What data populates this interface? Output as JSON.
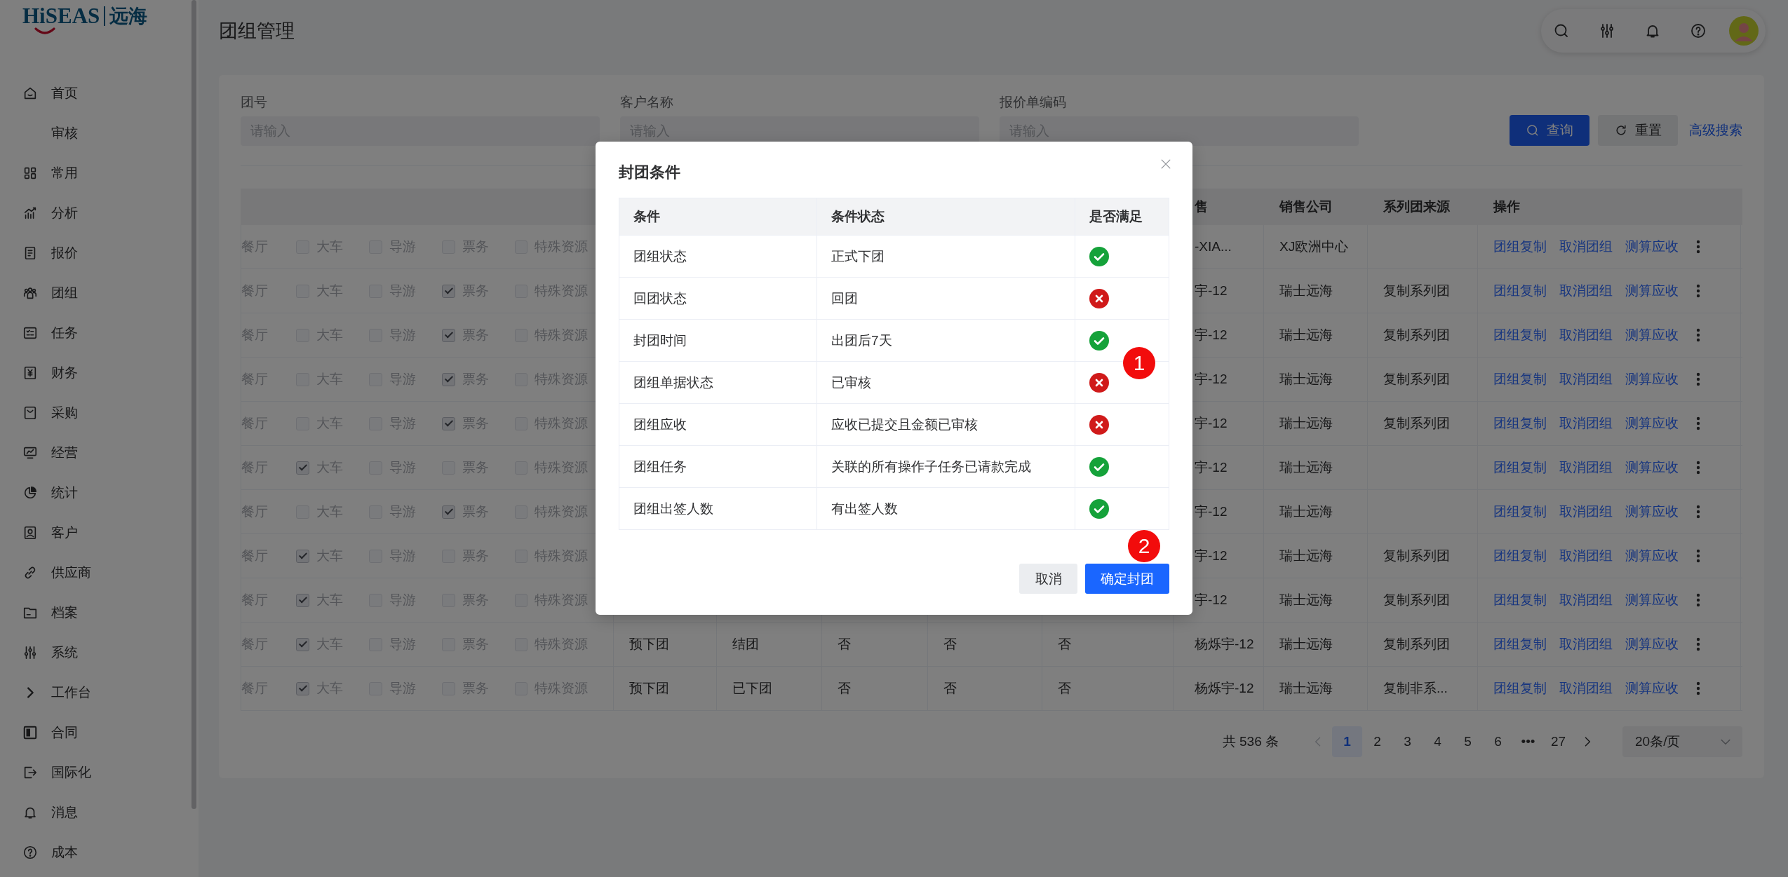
{
  "logo": {
    "name": "HiSEAS",
    "name_cn": "远海"
  },
  "sidebar": {
    "items": [
      {
        "label": "首页"
      },
      {
        "label": "审核"
      },
      {
        "label": "常用"
      },
      {
        "label": "分析"
      },
      {
        "label": "报价"
      },
      {
        "label": "团组"
      },
      {
        "label": "任务"
      },
      {
        "label": "财务"
      },
      {
        "label": "采购"
      },
      {
        "label": "经营"
      },
      {
        "label": "统计"
      },
      {
        "label": "客户"
      },
      {
        "label": "供应商"
      },
      {
        "label": "档案"
      },
      {
        "label": "系统"
      },
      {
        "label": "工作台"
      },
      {
        "label": "合同"
      },
      {
        "label": "国际化"
      },
      {
        "label": "消息"
      },
      {
        "label": "成本"
      }
    ]
  },
  "header": {
    "title": "团组管理"
  },
  "filters": {
    "fields": [
      {
        "label": "团号",
        "placeholder": "请输入"
      },
      {
        "label": "客户名称",
        "placeholder": "请输入"
      },
      {
        "label": "报价单编码",
        "placeholder": "请输入"
      }
    ],
    "buttons": [
      {
        "label": "查询",
        "kind": "primary"
      },
      {
        "label": "重置",
        "kind": "secondary"
      },
      {
        "label": "高级搜索",
        "kind": "link"
      }
    ]
  },
  "table": {
    "columns": {
      "sales": "售",
      "company": "销售公司",
      "source": "系列团来源",
      "actions": "操作"
    },
    "rows": [
      {
        "resource_label": "餐厅",
        "resources": [
          {
            "label": "大车",
            "checked": false
          },
          {
            "label": "导游",
            "checked": false
          },
          {
            "label": "票务",
            "checked": false
          },
          {
            "label": "特殊资源",
            "checked": false
          }
        ],
        "sales": "-XIA...",
        "company": "XJ欧洲中心",
        "actions": [
          "团组复制",
          "取消团组",
          "测算应收"
        ]
      },
      {
        "resource_label": "餐厅",
        "resources": [
          {
            "label": "大车",
            "checked": false
          },
          {
            "label": "导游",
            "checked": false
          },
          {
            "label": "票务",
            "checked": true
          },
          {
            "label": "特殊资源",
            "checked": false
          }
        ],
        "sales": "宇-12",
        "company": "瑞士远海",
        "source": "复制系列团",
        "actions": [
          "团组复制",
          "取消团组",
          "测算应收"
        ]
      },
      {
        "resource_label": "餐厅",
        "resources": [
          {
            "label": "大车",
            "checked": false
          },
          {
            "label": "导游",
            "checked": false
          },
          {
            "label": "票务",
            "checked": true
          },
          {
            "label": "特殊资源",
            "checked": false
          }
        ],
        "sales": "宇-12",
        "company": "瑞士远海",
        "source": "复制系列团",
        "actions": [
          "团组复制",
          "取消团组",
          "测算应收"
        ]
      },
      {
        "resource_label": "餐厅",
        "resources": [
          {
            "label": "大车",
            "checked": false
          },
          {
            "label": "导游",
            "checked": false
          },
          {
            "label": "票务",
            "checked": true
          },
          {
            "label": "特殊资源",
            "checked": false
          }
        ],
        "sales": "宇-12",
        "company": "瑞士远海",
        "source": "复制系列团",
        "actions": [
          "团组复制",
          "取消团组",
          "测算应收"
        ]
      },
      {
        "resource_label": "餐厅",
        "resources": [
          {
            "label": "大车",
            "checked": false
          },
          {
            "label": "导游",
            "checked": false
          },
          {
            "label": "票务",
            "checked": true
          },
          {
            "label": "特殊资源",
            "checked": false
          }
        ],
        "sales": "宇-12",
        "company": "瑞士远海",
        "source": "复制系列团",
        "actions": [
          "团组复制",
          "取消团组",
          "测算应收"
        ]
      },
      {
        "resource_label": "餐厅",
        "resources": [
          {
            "label": "大车",
            "checked": true
          },
          {
            "label": "导游",
            "checked": false
          },
          {
            "label": "票务",
            "checked": false
          },
          {
            "label": "特殊资源",
            "checked": false
          }
        ],
        "sales": "宇-12",
        "company": "瑞士远海",
        "actions": [
          "团组复制",
          "取消团组",
          "测算应收"
        ]
      },
      {
        "resource_label": "餐厅",
        "resources": [
          {
            "label": "大车",
            "checked": false
          },
          {
            "label": "导游",
            "checked": false
          },
          {
            "label": "票务",
            "checked": true
          },
          {
            "label": "特殊资源",
            "checked": false
          }
        ],
        "sales": "宇-12",
        "company": "瑞士远海",
        "actions": [
          "团组复制",
          "取消团组",
          "测算应收"
        ]
      },
      {
        "resource_label": "餐厅",
        "resources": [
          {
            "label": "大车",
            "checked": true
          },
          {
            "label": "导游",
            "checked": false
          },
          {
            "label": "票务",
            "checked": false
          },
          {
            "label": "特殊资源",
            "checked": false
          }
        ],
        "sales": "宇-12",
        "company": "瑞士远海",
        "source": "复制系列团",
        "actions": [
          "团组复制",
          "取消团组",
          "测算应收"
        ]
      },
      {
        "resource_label": "餐厅",
        "resources": [
          {
            "label": "大车",
            "checked": true
          },
          {
            "label": "导游",
            "checked": false
          },
          {
            "label": "票务",
            "checked": false
          },
          {
            "label": "特殊资源",
            "checked": false
          }
        ],
        "sales": "宇-12",
        "company": "瑞士远海",
        "source": "复制系列团",
        "actions": [
          "团组复制",
          "取消团组",
          "测算应收"
        ]
      },
      {
        "resource_label": "餐厅",
        "resources": [
          {
            "label": "大车",
            "checked": true
          },
          {
            "label": "导游",
            "checked": false
          },
          {
            "label": "票务",
            "checked": false
          },
          {
            "label": "特殊资源",
            "checked": false
          }
        ],
        "column_2": "预下团",
        "column_3": "结团",
        "column_4": "否",
        "column_5": "否",
        "column_6": "否",
        "sales": "杨烁宇-12",
        "company": "瑞士远海",
        "source": "复制系列团",
        "actions": [
          "团组复制",
          "取消团组",
          "测算应收"
        ]
      },
      {
        "resource_label": "餐厅",
        "resources": [
          {
            "label": "大车",
            "checked": true
          },
          {
            "label": "导游",
            "checked": false
          },
          {
            "label": "票务",
            "checked": false
          },
          {
            "label": "特殊资源",
            "checked": false
          }
        ],
        "column_2": "预下团",
        "column_3": "已下团",
        "column_4": "否",
        "column_5": "否",
        "column_6": "否",
        "sales": "杨烁宇-12",
        "company": "瑞士远海",
        "source": "复制非系...",
        "actions": [
          "团组复制",
          "取消团组",
          "测算应收"
        ]
      }
    ]
  },
  "pagination": {
    "total": "共 536 条",
    "prev": {
      "disabled": true
    },
    "next": {
      "disabled": false
    },
    "pages": [
      {
        "label": "1",
        "selected": true
      },
      {
        "label": "2",
        "selected": false
      },
      {
        "label": "3",
        "selected": false
      },
      {
        "label": "4",
        "selected": false
      },
      {
        "label": "5",
        "selected": false
      },
      {
        "label": "6",
        "selected": false
      },
      {
        "label": "•••",
        "selected": false
      },
      {
        "label": "27",
        "selected": false
      }
    ],
    "page_size": "20条/页"
  },
  "dialog": {
    "title": "封团条件",
    "columns": [
      "条件",
      "条件状态",
      "是否满足"
    ],
    "conditions": [
      {
        "condition": "团组状态",
        "status": "正式下团",
        "met": true
      },
      {
        "condition": "回团状态",
        "status": "回团",
        "met": false
      },
      {
        "condition": "封团时间",
        "status": "出团后7天",
        "met": true
      },
      {
        "condition": "团组单据状态",
        "status": "已审核",
        "met": false
      },
      {
        "condition": "团组应收",
        "status": "应收已提交且金额已审核",
        "met": false
      },
      {
        "condition": "团组任务",
        "status": "关联的所有操作子任务已请款完成",
        "met": true
      },
      {
        "condition": "团组出签人数",
        "status": "有出签人数",
        "met": true
      }
    ],
    "buttons": [
      {
        "label": "取消",
        "kind": "secondary"
      },
      {
        "label": "确定封团",
        "kind": "primary"
      }
    ]
  },
  "annotations": [
    {
      "label": "1"
    },
    {
      "label": "2"
    }
  ]
}
